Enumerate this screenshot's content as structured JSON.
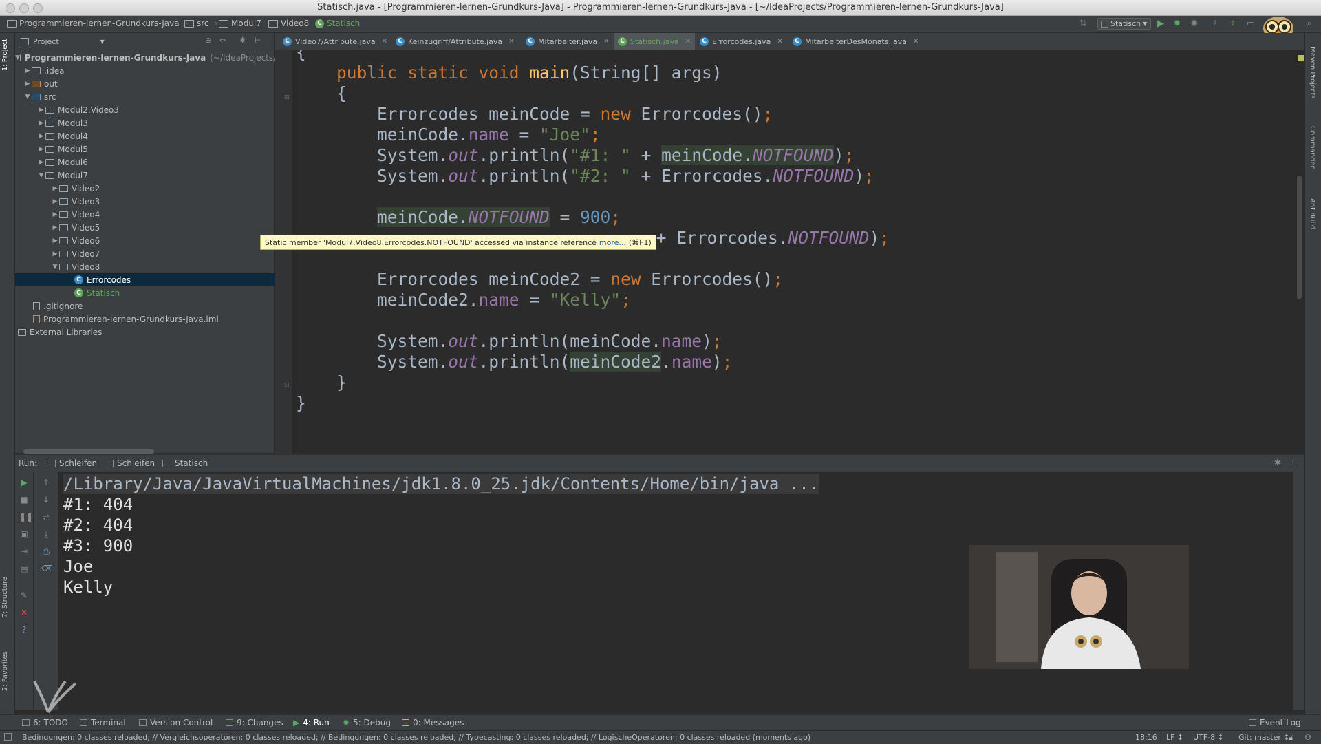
{
  "window": {
    "title": "Statisch.java - [Programmieren-lernen-Grundkurs-Java] - Programmieren-lernen-Grundkurs-Java - [~/IdeaProjects/Programmieren-lernen-Grundkurs-Java]"
  },
  "navbar": {
    "breadcrumbs": [
      "Programmieren-lernen-Grundkurs-Java",
      "src",
      "Modul7",
      "Video8",
      "Statisch"
    ],
    "run_config": "Statisch"
  },
  "left_strip": {
    "project": "1: Project",
    "structure": "7: Structure",
    "favorites": "2: Favorites"
  },
  "right_strip": {
    "maven": "Maven Projects",
    "commander": "Commander",
    "ant": "Ant Build"
  },
  "project_panel": {
    "header": "Project",
    "tree": [
      {
        "label": "Programmieren-lernen-Grundkurs-Java",
        "suffix": "(~/IdeaProjects/P"
      },
      {
        "label": ".idea"
      },
      {
        "label": "out"
      },
      {
        "label": "src"
      },
      {
        "label": "Modul2.Video3"
      },
      {
        "label": "Modul3"
      },
      {
        "label": "Modul4"
      },
      {
        "label": "Modul5"
      },
      {
        "label": "Modul6"
      },
      {
        "label": "Modul7"
      },
      {
        "label": "Video2"
      },
      {
        "label": "Video3"
      },
      {
        "label": "Video4"
      },
      {
        "label": "Video5"
      },
      {
        "label": "Video6"
      },
      {
        "label": "Video7"
      },
      {
        "label": "Video8"
      },
      {
        "label": "Errorcodes"
      },
      {
        "label": "Statisch"
      },
      {
        "label": ".gitignore"
      },
      {
        "label": "Programmieren-lernen-Grundkurs-Java.iml"
      },
      {
        "label": "External Libraries"
      }
    ]
  },
  "tabs": [
    {
      "label": "Video7/Attribute.java"
    },
    {
      "label": "Keinzugriff/Attribute.java"
    },
    {
      "label": "Mitarbeiter.java"
    },
    {
      "label": "Statisch.java"
    },
    {
      "label": "Errorcodes.java"
    },
    {
      "label": "MitarbeiterDesMonats.java"
    }
  ],
  "editor": {
    "lines": {
      "l0": "{",
      "l1_kw": "public static void ",
      "l1_fn": "main",
      "l1_rest": "(String[] args)",
      "l2": "{",
      "l3_a": "Errorcodes meinCode = ",
      "l3_kw": "new ",
      "l3_b": "Errorcodes()",
      "l3_c": ";",
      "l4_a": "meinCode.",
      "l4_f": "name",
      "l4_b": " = ",
      "l4_s": "\"Joe\"",
      "l4_c": ";",
      "l5_a": "System.",
      "l5_out": "out",
      "l5_b": ".println(",
      "l5_s": "\"#1: \"",
      "l5_c": " + ",
      "l5_hl": "meinCode.",
      "l5_f": "NOTFOUND",
      "l5_d": ")",
      "l5_e": ";",
      "l6_a": "System.",
      "l6_out": "out",
      "l6_b": ".println(",
      "l6_s": "\"#2: \"",
      "l6_c": " + Errorcodes.",
      "l6_f": "NOTFOUND",
      "l6_d": ")",
      "l6_e": ";",
      "l7_hl": "meinCode.",
      "l7_f": "NOTFOUND",
      "l7_b": " = ",
      "l7_n": "900",
      "l7_c": ";",
      "l8_c": " + Errorcodes.",
      "l8_f": "NOTFOUND",
      "l8_d": ")",
      "l8_e": ";",
      "l9_a": "Errorcodes meinCode2 = ",
      "l9_kw": "new ",
      "l9_b": "Errorcodes()",
      "l9_c": ";",
      "l10_a": "meinCode2.",
      "l10_f": "name",
      "l10_b": " = ",
      "l10_s": "\"Kelly\"",
      "l10_c": ";",
      "l11_a": "System.",
      "l11_out": "out",
      "l11_b": ".println(meinCode.",
      "l11_f": "name",
      "l11_c": ")",
      "l11_e": ";",
      "l12_a": "System.",
      "l12_out": "out",
      "l12_b": ".println(",
      "l12_hl": "meinCode2",
      "l12_c": ".",
      "l12_f": "name",
      "l12_d": ")",
      "l12_e": ";",
      "l13": "}",
      "l14": "}"
    },
    "tooltip": {
      "text": "Static member 'Modul7.Video8.Errorcodes.NOTFOUND' accessed via instance reference",
      "link": "more...",
      "shortcut": "(⌘F1)"
    }
  },
  "run_panel": {
    "label": "Run:",
    "tabs": [
      "Schleifen",
      "Schleifen",
      "Statisch"
    ],
    "output": [
      "/Library/Java/JavaVirtualMachines/jdk1.8.0_25.jdk/Contents/Home/bin/java ...",
      "#1: 404",
      "#2: 404",
      "#3: 900",
      "Joe",
      "Kelly"
    ]
  },
  "bottom_tools": [
    {
      "label": "6: TODO"
    },
    {
      "label": "Terminal"
    },
    {
      "label": "Version Control"
    },
    {
      "label": "9: Changes"
    },
    {
      "label": "4: Run"
    },
    {
      "label": "5: Debug"
    },
    {
      "label": "0: Messages"
    }
  ],
  "event_log": "Event Log",
  "status": {
    "message": "Bedingungen: 0 classes reloaded; // Vergleichsoperatoren: 0 classes reloaded; // Bedingungen: 0 classes reloaded; // Typecasting: 0 classes reloaded; // LogischeOperatoren: 0 classes reloaded (moments ago)",
    "position": "18:16",
    "line_sep": "LF ↕",
    "encoding": "UTF-8 ↕",
    "vcs": "Git: master ↕"
  },
  "colors": {
    "keyword": "#cc7832",
    "string": "#6a8759",
    "number": "#6897bb",
    "field": "#9876aa",
    "method": "#ffc66d",
    "selection": "#0d293e"
  }
}
